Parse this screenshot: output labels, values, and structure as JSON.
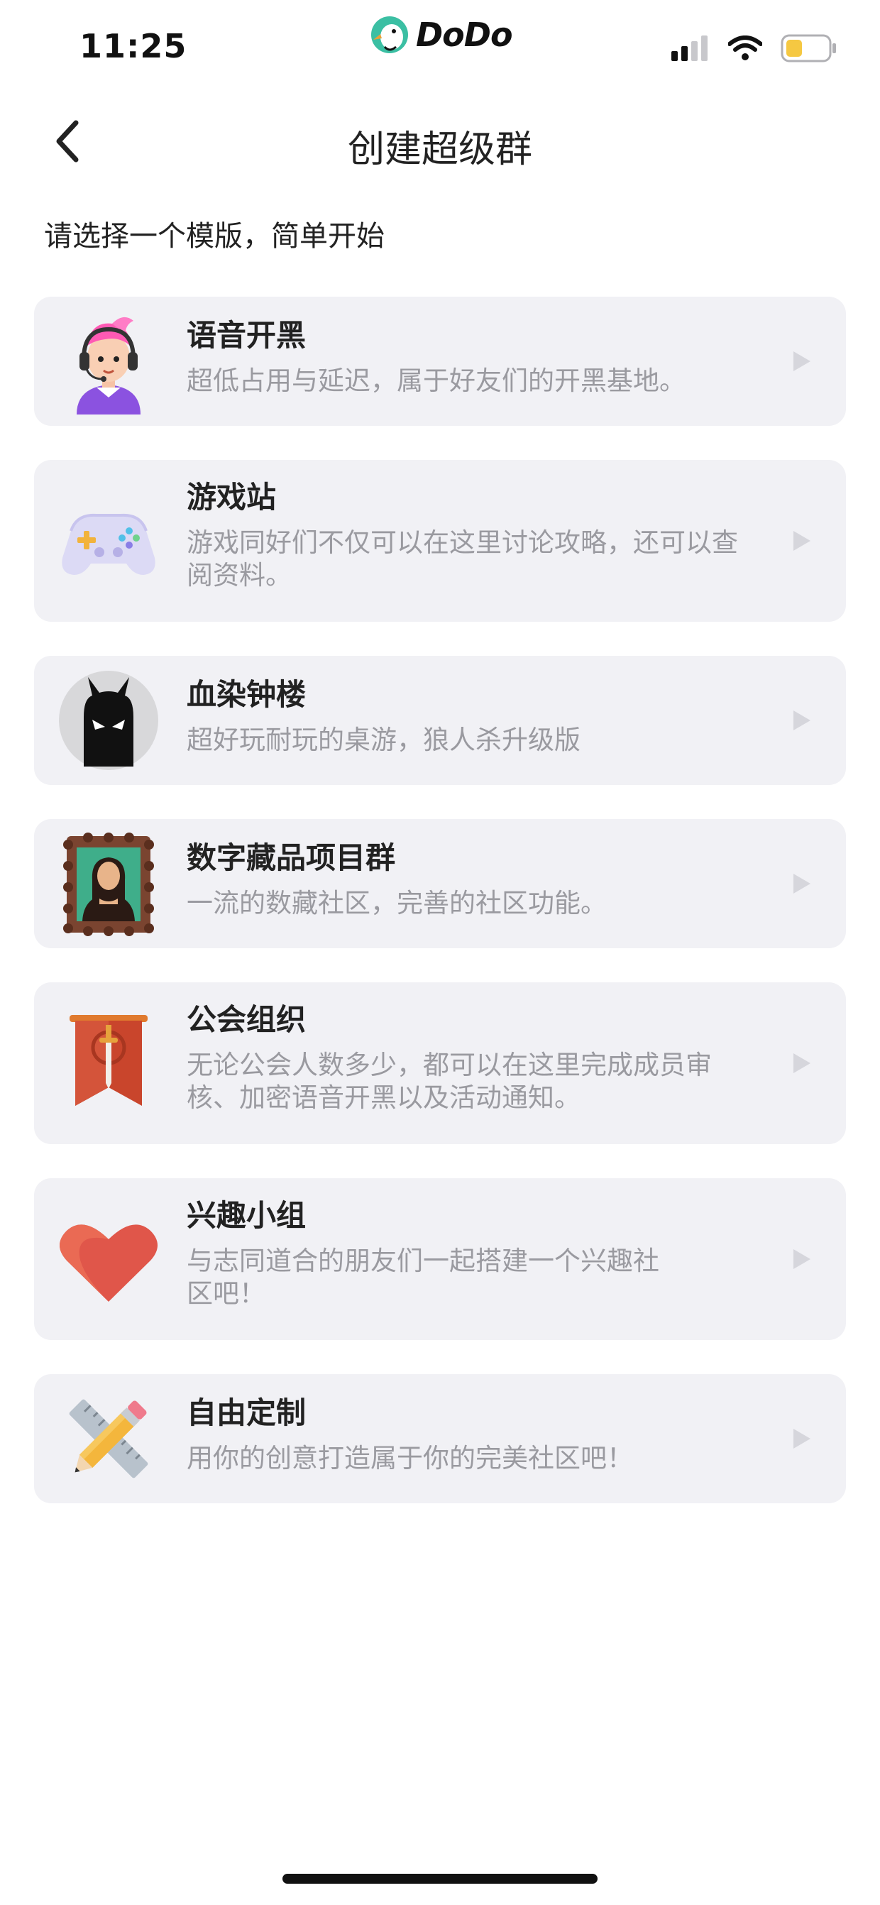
{
  "status_bar": {
    "time": "11:25",
    "brand": "DoDo",
    "icons": [
      "cellular-signal-icon",
      "wifi-icon",
      "battery-icon"
    ]
  },
  "nav": {
    "back_icon": "chevron-left-icon",
    "title": "创建超级群"
  },
  "subtitle": "请选择一个模版，简单开始",
  "templates": [
    {
      "icon": "gamer-headset-icon",
      "title": "语音开黑",
      "desc": "超低占用与延迟，属于好友们的开黑基地。"
    },
    {
      "icon": "gamepad-icon",
      "title": "游戏站",
      "desc": "游戏同好们不仅可以在这里讨论攻略，还可以查阅资料。"
    },
    {
      "icon": "devil-icon",
      "title": "血染钟楼",
      "desc": "超好玩耐玩的桌游，狼人杀升级版"
    },
    {
      "icon": "mona-lisa-frame-icon",
      "title": "数字藏品项目群",
      "desc": "一流的数藏社区，完善的社区功能。"
    },
    {
      "icon": "guild-banner-icon",
      "title": "公会组织",
      "desc": "无论公会人数多少，都可以在这里完成成员审核、加密语音开黑以及活动通知。"
    },
    {
      "icon": "heart-icon",
      "title": "兴趣小组",
      "desc": "与志同道合的朋友们一起搭建一个兴趣社区吧！"
    },
    {
      "icon": "pencil-ruler-icon",
      "title": "自由定制",
      "desc": "用你的创意打造属于你的完美社区吧！"
    }
  ],
  "colors": {
    "card_bg": "#f1f1f5",
    "desc_text": "#9a9aa0",
    "arrow": "#d6d6dc"
  }
}
